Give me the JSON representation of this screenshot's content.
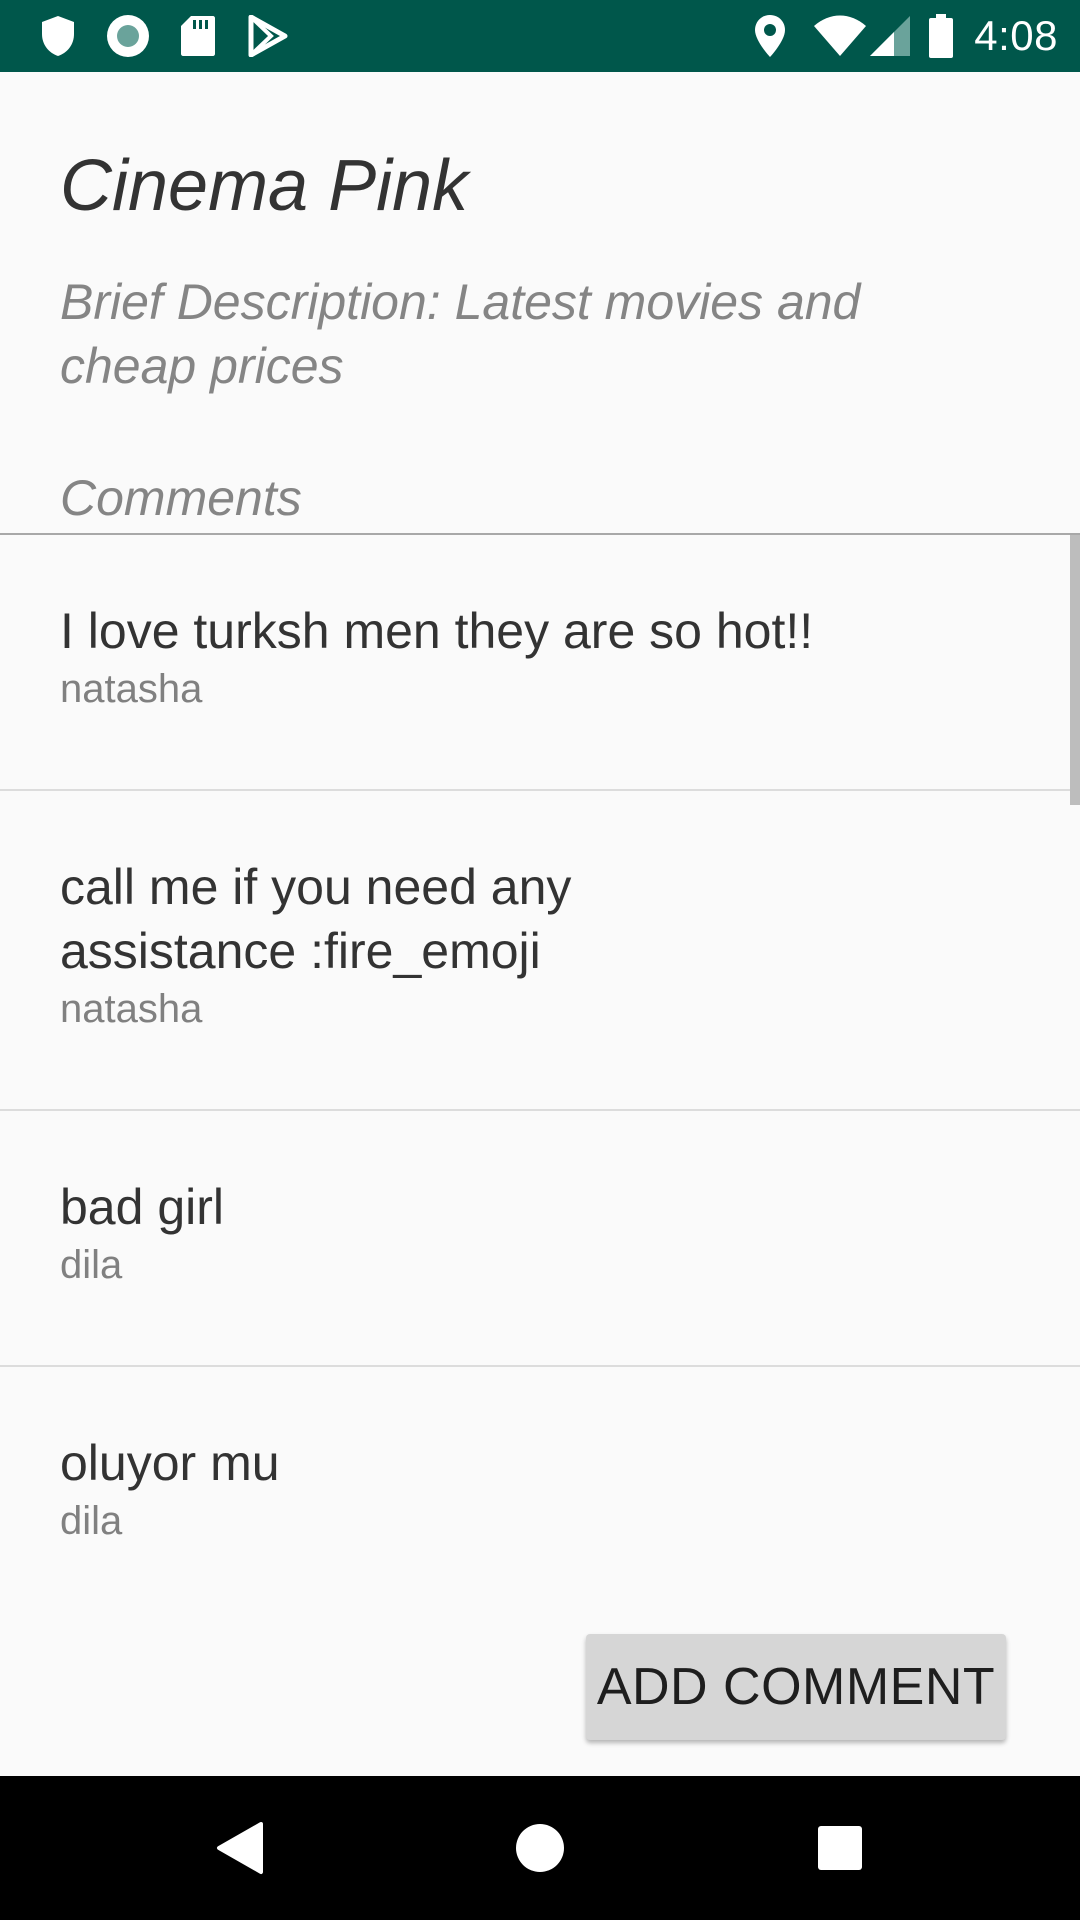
{
  "status_bar": {
    "time": "4:08",
    "left_icons": [
      "shield-icon",
      "record-icon",
      "sd-card-icon",
      "play-store-icon"
    ],
    "right_icons": [
      "location-icon",
      "wifi-icon",
      "signal-icon",
      "battery-icon"
    ],
    "background_color": "#00574b"
  },
  "header": {
    "title": "Cinema Pink",
    "description": "Brief Description: Latest movies and cheap prices"
  },
  "comments": {
    "label": "Comments",
    "items": [
      {
        "text": "I love turksh men they are so hot!!",
        "author": "natasha"
      },
      {
        "text": "call me if you need any assistance :fire_emoji",
        "author": "natasha"
      },
      {
        "text": "bad girl",
        "author": "dila"
      },
      {
        "text": "oluyor mu",
        "author": "dila"
      }
    ]
  },
  "actions": {
    "add_comment_label": "ADD COMMENT"
  },
  "nav_bar": {
    "icons": [
      "back-icon",
      "home-icon",
      "recents-icon"
    ]
  }
}
